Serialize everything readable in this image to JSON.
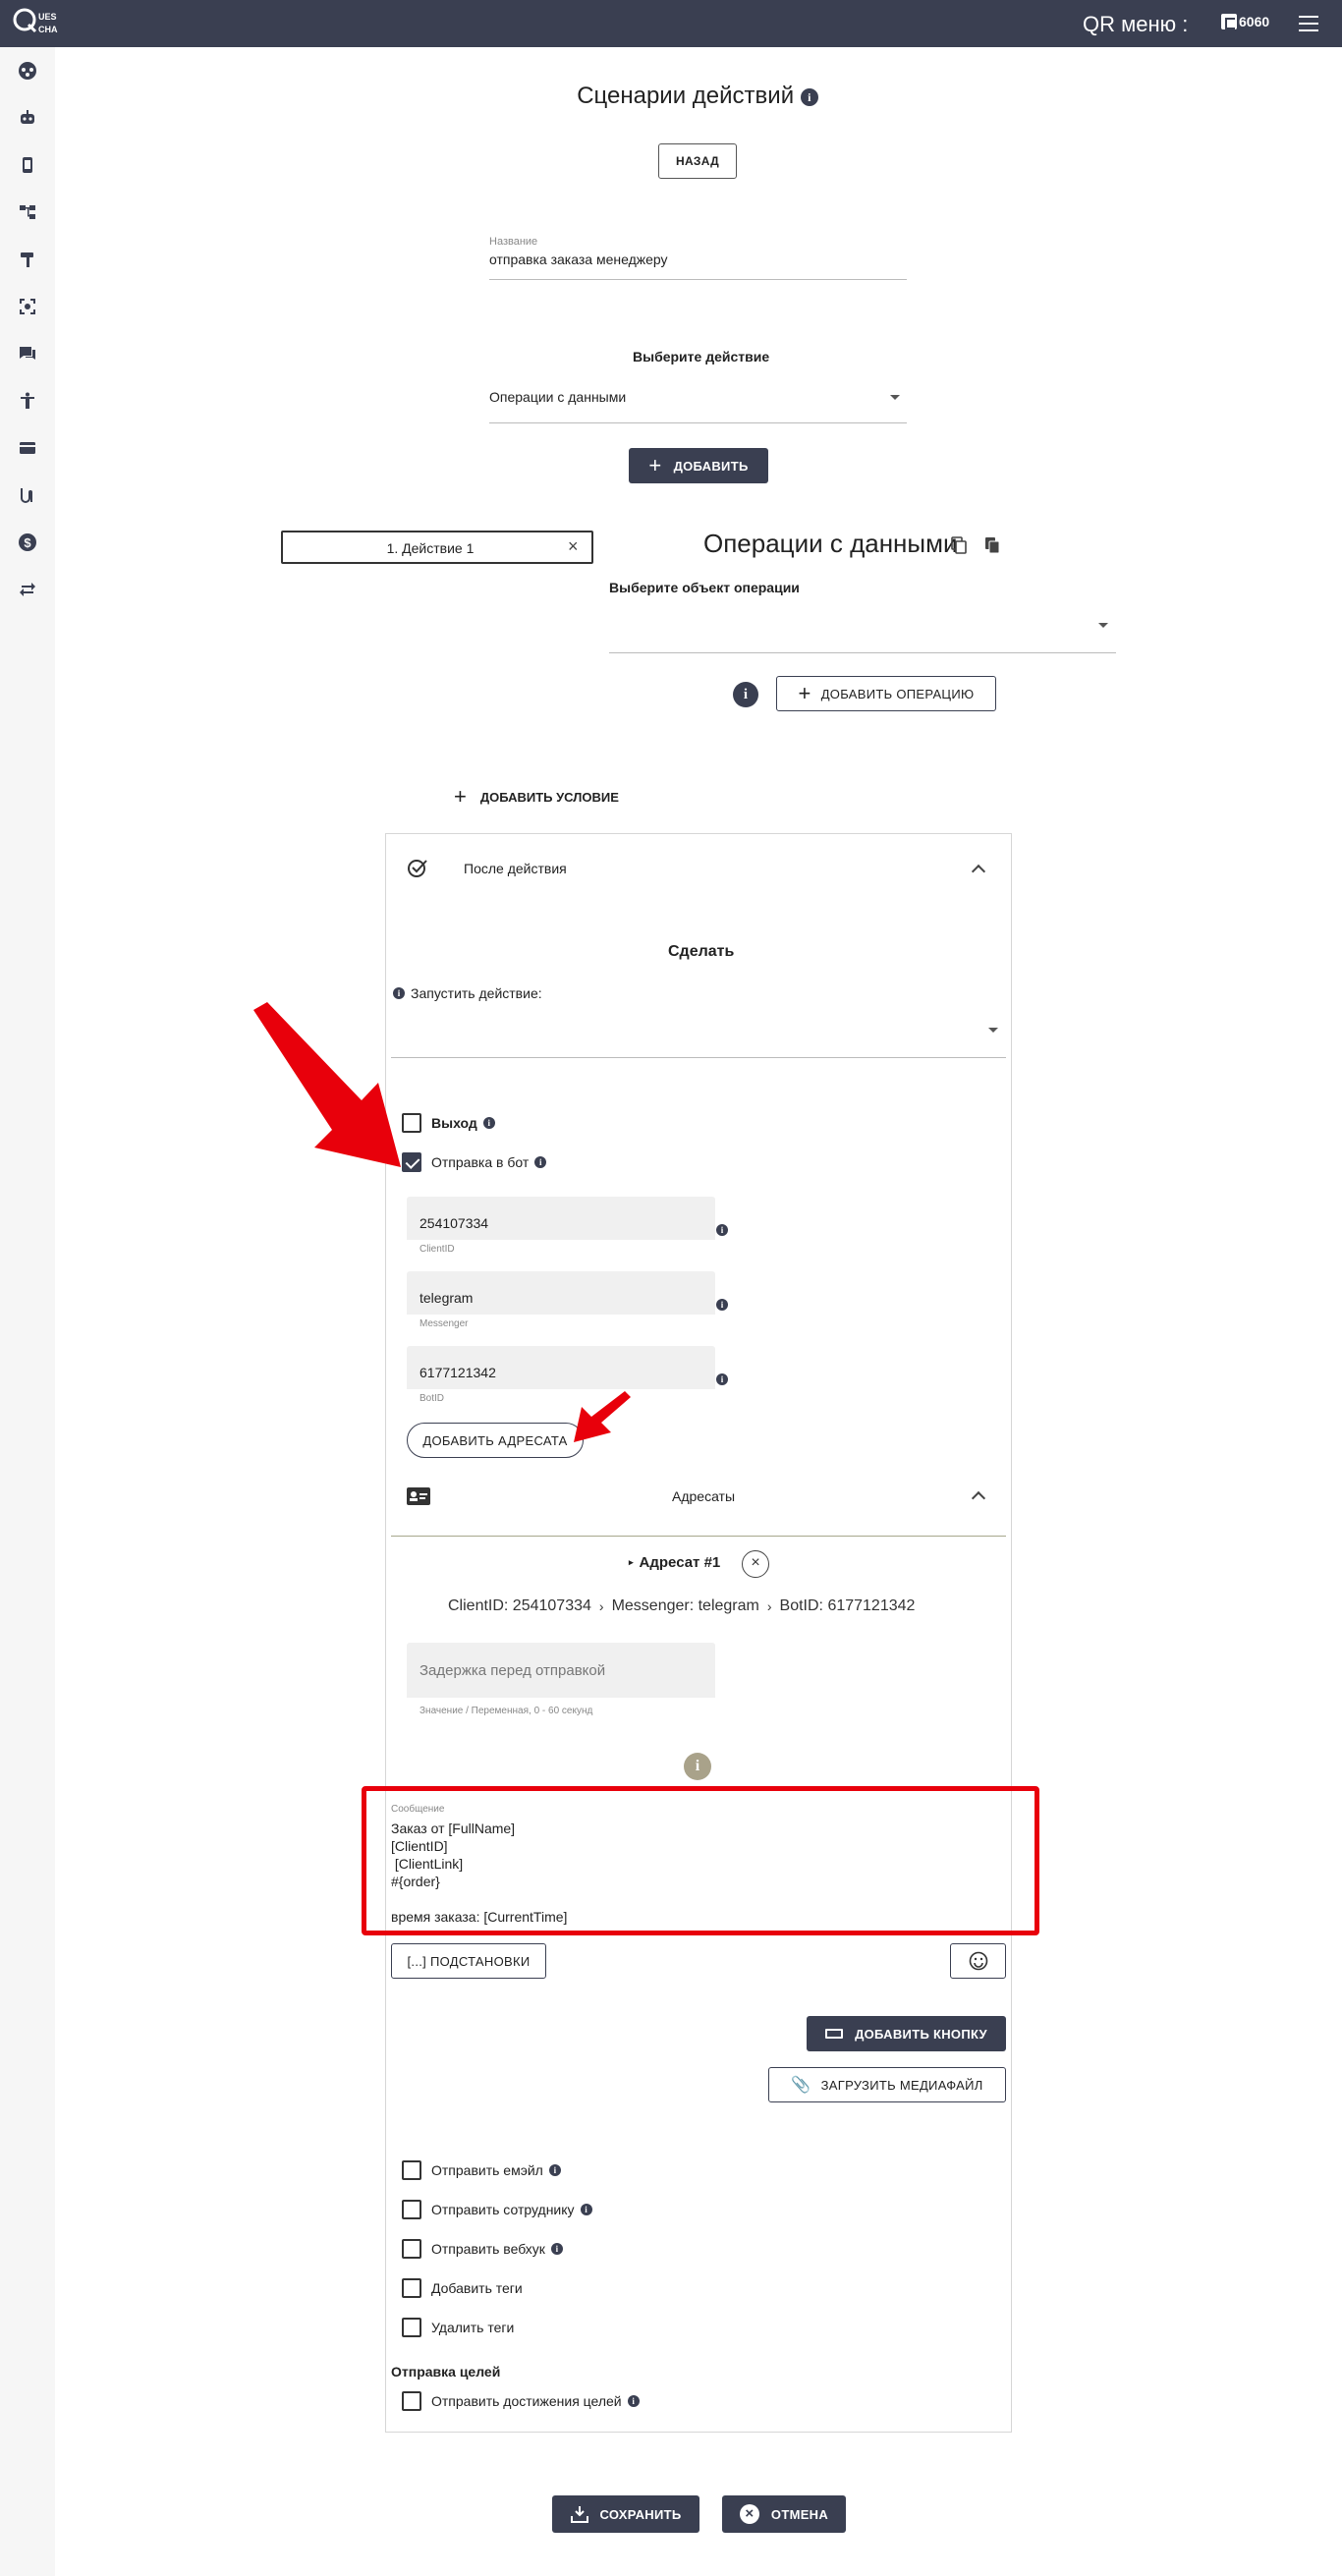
{
  "topbar": {
    "logo_text": "QUES CHA",
    "qr_menu": "QR меню :",
    "balance": "6060"
  },
  "sidebar": {
    "icons": [
      "dashboard-icon",
      "robot-icon",
      "mobile-icon",
      "sitemap-icon",
      "hammer-icon",
      "scan-icon",
      "chat-icon",
      "user-icon",
      "card-icon",
      "route-icon",
      "dollar-icon",
      "swap-icon"
    ]
  },
  "page": {
    "title": "Сценарии действий",
    "back_button": "НАЗАД",
    "name_label": "Название",
    "name_value": "отправка заказа менеджеру",
    "select_action_label": "Выберите действие",
    "select_action_value": "Операции с данными",
    "add_button": "ДОБАВИТЬ"
  },
  "action": {
    "tab_label": "1. Действие 1",
    "section_title": "Операции с данными",
    "object_label": "Выберите объект операции",
    "add_operation": "ДОБАВИТЬ ОПЕРАЦИЮ",
    "add_condition": "ДОБАВИТЬ УСЛОВИЕ"
  },
  "after": {
    "header": "После действия",
    "do_title": "Сделать",
    "run_action_label": "Запустить действие:",
    "exit_label": "Выход",
    "send_bot_label": "Отправка в бот",
    "client_id_value": "254107334",
    "client_id_label": "ClientID",
    "messenger_value": "telegram",
    "messenger_label": "Messenger",
    "bot_id_value": "6177121342",
    "bot_id_label": "BotID",
    "add_recipient": "ДОБАВИТЬ АДРЕСАТА",
    "recipients_header": "Адресаты",
    "recipient_title": "Адресат #1",
    "crumb_client": "ClientID: 254107334",
    "crumb_messenger": "Messenger: telegram",
    "crumb_bot": "BotID: 6177121342",
    "delay_placeholder": "Задержка перед отправкой",
    "delay_hint": "Значение / Переменная, 0 - 60 секунд",
    "message_label": "Сообщение",
    "message_text": "Заказ от [FullName]\n[ClientID]\n [ClientLink]\n#{order}\n\nвремя заказа: [CurrentTime]",
    "substitutions": "[...] ПОДСТАНОВКИ",
    "add_button_btn": "ДОБАВИТЬ КНОПКУ",
    "upload_media": "ЗАГРУЗИТЬ МЕДИАФАЙЛ",
    "send_email": "Отправить емэйл",
    "send_employee": "Отправить сотруднику",
    "send_webhook": "Отправить вебхук",
    "add_tags": "Добавить теги",
    "remove_tags": "Удалить теги",
    "goals_title": "Отправка целей",
    "send_goals": "Отправить достижения целей"
  },
  "footer": {
    "save": "СОХРАНИТЬ",
    "cancel": "ОТМЕНА"
  },
  "colors": {
    "dark": "#3a3f51",
    "highlight": "#e8000b"
  }
}
